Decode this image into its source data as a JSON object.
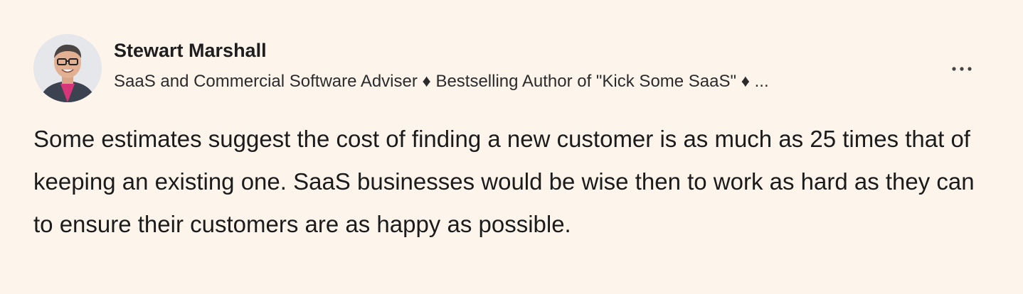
{
  "post": {
    "author": {
      "name": "Stewart Marshall",
      "headline": "SaaS and Commercial Software Adviser ♦ Bestselling Author of \"Kick Some SaaS\" ♦ ...",
      "avatar_icon": "profile-photo"
    },
    "more_icon": "more-options-icon",
    "text": "Some estimates suggest the cost of finding a new customer is as much as 25 times that of keeping an existing one. SaaS businesses would be wise then to work as hard as they can to ensure their customers are as happy as possible."
  },
  "colors": {
    "background": "#fdf5ec",
    "text": "#1b1b1b"
  }
}
